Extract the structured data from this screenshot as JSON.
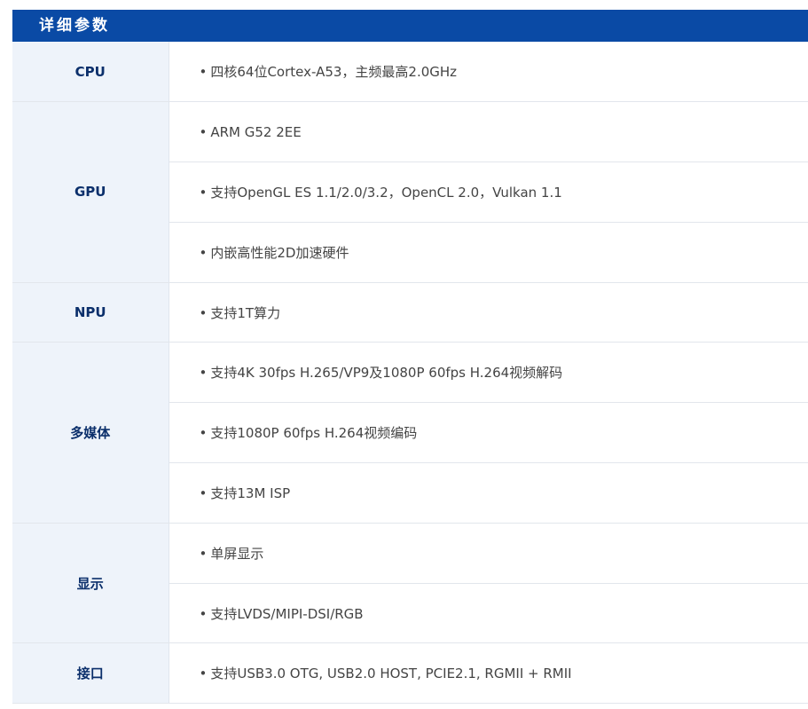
{
  "header": {
    "title": "详细参数"
  },
  "specs": [
    {
      "label": "CPU",
      "values": [
        "四核64位Cortex-A53，主频最高2.0GHz"
      ]
    },
    {
      "label": "GPU",
      "values": [
        "ARM G52 2EE",
        "支持OpenGL ES 1.1/2.0/3.2，OpenCL 2.0，Vulkan 1.1",
        "内嵌高性能2D加速硬件"
      ]
    },
    {
      "label": "NPU",
      "values": [
        "支持1T算力"
      ]
    },
    {
      "label": "多媒体",
      "values": [
        "支持4K 30fps H.265/VP9及1080P 60fps H.264视频解码",
        "支持1080P 60fps H.264视频编码",
        "支持13M ISP"
      ]
    },
    {
      "label": "显示",
      "values": [
        "单屏显示",
        "支持LVDS/MIPI-DSI/RGB"
      ]
    },
    {
      "label": "接口",
      "values": [
        "支持USB3.0 OTG, USB2.0 HOST, PCIE2.1, RGMII + RMII"
      ]
    }
  ],
  "bullet_char": "•"
}
